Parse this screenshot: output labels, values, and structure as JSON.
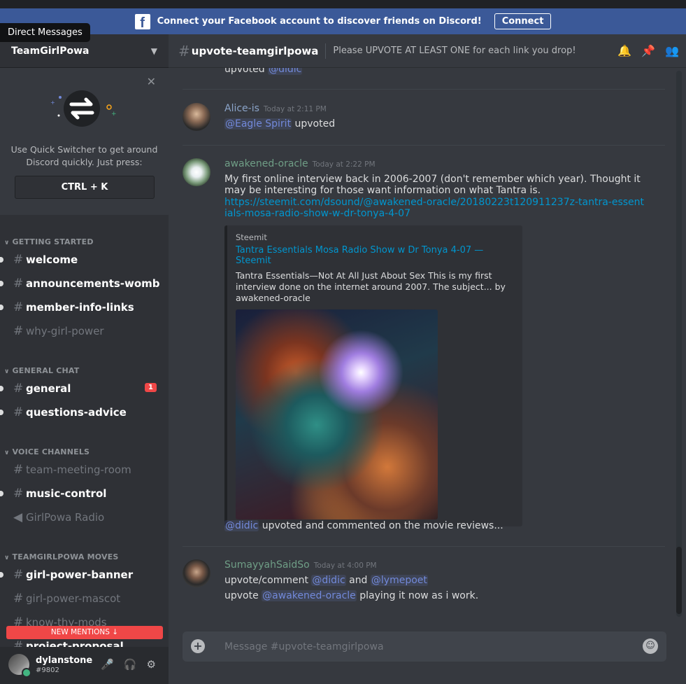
{
  "facebook_bar": {
    "logo": "f",
    "text": "Connect your Facebook account to discover friends on Discord!",
    "button": "Connect"
  },
  "tooltip": "Direct Messages",
  "guild": {
    "name": "TeamGirlPowa"
  },
  "quick_switcher": {
    "text": "Use Quick Switcher to get around Discord quickly. Just press:",
    "shortcut": "CTRL + K"
  },
  "categories": {
    "getting_started": "GETTING STARTED",
    "general_chat": "GENERAL CHAT",
    "voice_channels": "VOICE CHANNELS",
    "moves": "TEAMGIRLPOWA MOVES"
  },
  "channels": {
    "welcome": "welcome",
    "announcements": "announcements-womb",
    "member_info": "member-info-links",
    "why_girl_power": "why-girl-power",
    "general": "general",
    "general_badge": "1",
    "questions": "questions-advice",
    "team_meeting": "team-meeting-room",
    "music_control": "music-control",
    "radio": "GirlPowa Radio",
    "banner": "girl-power-banner",
    "mascot": "girl-power-mascot",
    "mods": "know-thy-mods",
    "proposal": "project-proposal"
  },
  "new_mentions": "NEW MENTIONS",
  "user": {
    "name": "dylanstone",
    "tag": "#9802"
  },
  "channel_header": {
    "name": "upvote-teamgirlpowa",
    "topic": "Please UPVOTE AT LEAST ONE for each link you drop!"
  },
  "messages": {
    "top_fragment": {
      "text": "upvoted",
      "mention": "@didic"
    },
    "alice": {
      "author": "Alice-is",
      "author_color": "#8ba4c9",
      "timestamp": "Today at 2:11 PM",
      "mention": "@Eagle Spirit",
      "text": "upvoted"
    },
    "oracle": {
      "author": "awakened-oracle",
      "author_color": "#6f9e86",
      "timestamp": "Today at 2:22 PM",
      "text": "My first online interview back in 2006-2007 (don't remember which year). Thought it may be interesting for those want information on what Tantra is.",
      "link": "https://steemit.com/dsound/@awakened-oracle/20180223t120911237z-tantra-essentials-mosa-radio-show-w-dr-tonya-4-07",
      "embed": {
        "provider": "Steemit",
        "title": "Tantra Essentials Mosa Radio Show w Dr Tonya 4-07 — Steemit",
        "description": "Tantra Essentials—Not At All Just About Sex   This is my first interview done on the internet around 2007. The subject... by awakened-oracle"
      },
      "followup_mention": "@didic",
      "followup_text": "upvoted and commented on the movie reviews..."
    },
    "sumayyah": {
      "author": "SumayyahSaidSo",
      "author_color": "#6f9e86",
      "timestamp": "Today at 4:00 PM",
      "line1_text": "upvote/comment",
      "line1_mention1": "@didic",
      "line1_and": "and",
      "line1_mention2": "@lymepoet",
      "line2_text": "upvote",
      "line2_mention": "@awakened-oracle",
      "line2_rest": "playing it now as i work."
    }
  },
  "composer": {
    "placeholder": "Message #upvote-teamgirlpowa"
  }
}
